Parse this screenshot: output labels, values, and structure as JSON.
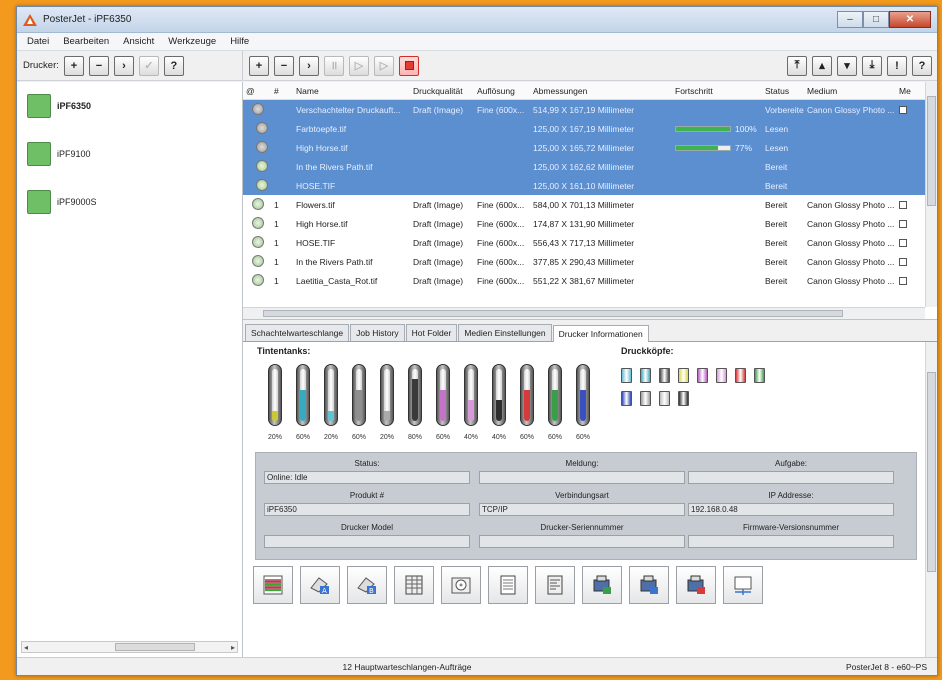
{
  "window": {
    "title": "PosterJet - iPF6350"
  },
  "menu": {
    "items": [
      "Datei",
      "Bearbeiten",
      "Ansicht",
      "Werkzeuge"
    ],
    "help": "Hilfe"
  },
  "toolbar": {
    "printer_label": "Drucker:"
  },
  "printers": [
    {
      "name": "iPF6350",
      "active": true
    },
    {
      "name": "iPF9100",
      "active": false
    },
    {
      "name": "iPF9000S",
      "active": false
    }
  ],
  "jobs": {
    "headers": [
      "@",
      "#",
      "Name",
      "Druckqualität",
      "Auflösung",
      "Abmessungen",
      "Fortschritt",
      "Status",
      "Medium",
      "Me"
    ],
    "rows": [
      {
        "num": "",
        "name": "Verschachtelter Druckauft...",
        "quality": "Draft (Image)",
        "res": "Fine (600x...",
        "dim": "514,99 X 167,19 Millimeter",
        "progress": "",
        "progress_value": null,
        "status": "Vorbereiten",
        "medium": "Canon Glossy Photo ...",
        "sel": true,
        "sub": false,
        "gear": true
      },
      {
        "num": "",
        "name": "Farbtoepfe.tif",
        "quality": "",
        "res": "",
        "dim": "125,00 X 167,19 Millimeter",
        "progress": "100%",
        "progress_value": 100,
        "status": "Lesen",
        "medium": "",
        "sel": true,
        "sub": true,
        "gear": true
      },
      {
        "num": "",
        "name": "High Horse.tif",
        "quality": "",
        "res": "",
        "dim": "125,00 X 165,72 Millimeter",
        "progress": "77%",
        "progress_value": 77,
        "status": "Lesen",
        "medium": "",
        "sel": true,
        "sub": true,
        "gear": true
      },
      {
        "num": "",
        "name": "In the Rivers Path.tif",
        "quality": "",
        "res": "",
        "dim": "125,00 X 162,62 Millimeter",
        "progress": "",
        "progress_value": null,
        "status": "Bereit",
        "medium": "",
        "sel": true,
        "sub": true,
        "gear": false
      },
      {
        "num": "",
        "name": "HOSE.TIF",
        "quality": "",
        "res": "",
        "dim": "125,00 X 161,10 Millimeter",
        "progress": "",
        "progress_value": null,
        "status": "Bereit",
        "medium": "",
        "sel": true,
        "sub": true,
        "gear": false
      },
      {
        "num": "1",
        "name": "Flowers.tif",
        "quality": "Draft (Image)",
        "res": "Fine (600x...",
        "dim": "584,00 X 701,13 Millimeter",
        "progress": "",
        "progress_value": null,
        "status": "Bereit",
        "medium": "Canon Glossy Photo ...",
        "sel": false,
        "sub": false,
        "gear": false
      },
      {
        "num": "1",
        "name": "High Horse.tif",
        "quality": "Draft (Image)",
        "res": "Fine (600x...",
        "dim": "174,87 X 131,90 Millimeter",
        "progress": "",
        "progress_value": null,
        "status": "Bereit",
        "medium": "Canon Glossy Photo ...",
        "sel": false,
        "sub": false,
        "gear": false
      },
      {
        "num": "1",
        "name": "HOSE.TIF",
        "quality": "Draft (Image)",
        "res": "Fine (600x...",
        "dim": "556,43 X 717,13 Millimeter",
        "progress": "",
        "progress_value": null,
        "status": "Bereit",
        "medium": "Canon Glossy Photo ...",
        "sel": false,
        "sub": false,
        "gear": false
      },
      {
        "num": "1",
        "name": "In the Rivers Path.tif",
        "quality": "Draft (Image)",
        "res": "Fine (600x...",
        "dim": "377,85 X 290,43 Millimeter",
        "progress": "",
        "progress_value": null,
        "status": "Bereit",
        "medium": "Canon Glossy Photo ...",
        "sel": false,
        "sub": false,
        "gear": false
      },
      {
        "num": "1",
        "name": "Laetitia_Casta_Rot.tif",
        "quality": "Draft (Image)",
        "res": "Fine (600x...",
        "dim": "551,22 X 381,67 Millimeter",
        "progress": "",
        "progress_value": null,
        "status": "Bereit",
        "medium": "Canon Glossy Photo ...",
        "sel": false,
        "sub": false,
        "gear": false
      }
    ]
  },
  "tabs": [
    "Schachtelwarteschlange",
    "Job History",
    "Hot Folder",
    "Medien Einstellungen",
    "Drucker Informationen"
  ],
  "active_tab": 4,
  "info": {
    "tanks_label": "Tintentanks:",
    "heads_label": "Druckköpfe:",
    "tanks": [
      {
        "color": "#c9c935",
        "percent": "20%",
        "level": 20
      },
      {
        "color": "#37a9c0",
        "percent": "60%",
        "level": 60
      },
      {
        "color": "#5ec4d4",
        "percent": "20%",
        "level": 20
      },
      {
        "color": "#8f8f8f",
        "percent": "60%",
        "level": 60
      },
      {
        "color": "#aaaaaa",
        "percent": "20%",
        "level": 20
      },
      {
        "color": "#3a3a3a",
        "percent": "80%",
        "level": 80
      },
      {
        "color": "#c373c8",
        "percent": "60%",
        "level": 60
      },
      {
        "color": "#d89bd9",
        "percent": "40%",
        "level": 40
      },
      {
        "color": "#2f2f2f",
        "percent": "40%",
        "level": 40
      },
      {
        "color": "#d63b3b",
        "percent": "60%",
        "level": 60
      },
      {
        "color": "#3a9e48",
        "percent": "60%",
        "level": 60
      },
      {
        "color": "#3b4fbf",
        "percent": "60%",
        "level": 60
      }
    ],
    "heads": [
      "#64bcd4",
      "#3aa7c4",
      "#4a4a4a",
      "#d8d84a",
      "#b65fbf",
      "#d69ad8",
      "#d43c3c",
      "#3f9e4a",
      "#2e47b8",
      "#9c9c9c",
      "#bdbdbd",
      "#2f2f2f"
    ],
    "fields": [
      {
        "label": "Status:",
        "value": "Online: Idle"
      },
      {
        "label": "Meldung:",
        "value": ""
      },
      {
        "label": "Aufgabe:",
        "value": ""
      },
      {
        "label": "Produkt #",
        "value": "iPF6350"
      },
      {
        "label": "Verbindungsart",
        "value": "TCP/IP"
      },
      {
        "label": "IP Addresse:",
        "value": "192.168.0.48"
      },
      {
        "label": "Drucker Model",
        "value": ""
      },
      {
        "label": "Drucker-Seriennummer",
        "value": ""
      },
      {
        "label": "Firmware-Versionsnummer",
        "value": ""
      }
    ]
  },
  "status": {
    "center": "12 Hauptwarteschlangen-Aufträge",
    "right": "PosterJet 8 - e60~PS"
  }
}
